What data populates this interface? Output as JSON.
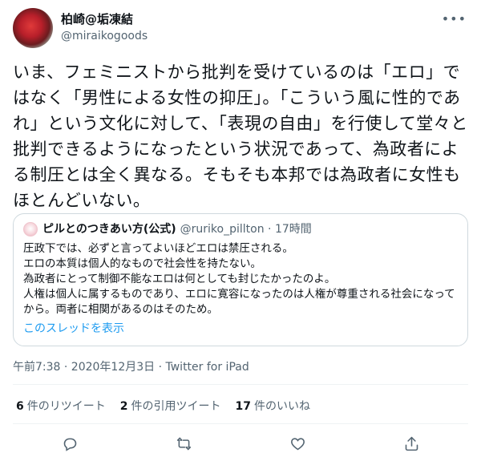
{
  "author": {
    "display_name": "柏崎@垢凍結",
    "handle": "@miraikogoods"
  },
  "more_icon": "•••",
  "tweet_text": "いま、フェミニストから批判を受けているのは「エロ」ではなく「男性による女性の抑圧」。「こういう風に性的であれ」という文化に対して、「表現の自由」を行使して堂々と批判できるようになったという状況であって、為政者による制圧とは全く異なる。そもそも本邦では為政者に女性もほとんどいない。",
  "quote": {
    "name": "ピルとのつきあい方(公式)",
    "meta": "@ruriko_pillton · 17時間",
    "text": "圧政下では、必ずと言ってよいほどエロは禁圧される。\nエロの本質は個人的なもので社会性を持たない。\n為政者にとって制御不能なエロは何としても封じたかったのよ。\n人権は個人に属するものであり、エロに寛容になったのは人権が尊重される社会になってから。両者に相関があるのはそのため。",
    "thread_link": "このスレッドを表示"
  },
  "timestamp": "午前7:38 · 2020年12月3日 · Twitter for iPad",
  "stats": {
    "retweets_count": "6",
    "retweets_label": "件のリツイート",
    "quotes_count": "2",
    "quotes_label": "件の引用ツイート",
    "likes_count": "17",
    "likes_label": "件のいいね"
  },
  "icons": {
    "reply": "reply-icon",
    "retweet": "retweet-icon",
    "like": "like-icon",
    "share": "share-icon"
  },
  "colors": {
    "link": "#1d9bf0",
    "secondary_text": "#536471",
    "border": "#cfd9de"
  }
}
